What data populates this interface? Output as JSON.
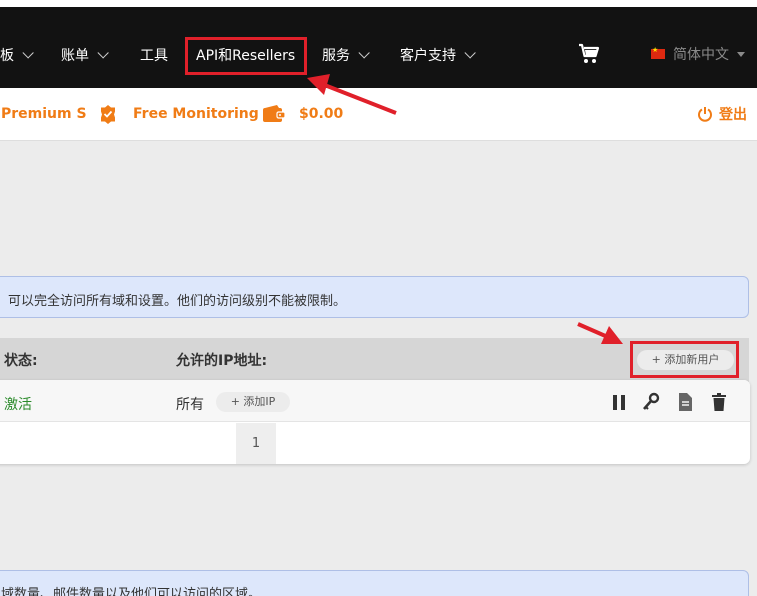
{
  "nav": {
    "items": [
      {
        "label": "板",
        "has_dropdown": true
      },
      {
        "label": "账单",
        "has_dropdown": true
      },
      {
        "label": "工具",
        "has_dropdown": false
      },
      {
        "label": "API和Resellers",
        "has_dropdown": false
      },
      {
        "label": "服务",
        "has_dropdown": true
      },
      {
        "label": "客户支持",
        "has_dropdown": true
      }
    ],
    "language": "简体中文"
  },
  "subbar": {
    "plan": "Premium S",
    "monitoring": "Free Monitoring",
    "balance": "$0.00",
    "logout": "登出"
  },
  "info_top": "可以完全访问所有域和设置。他们的访问级别不能被限制。",
  "table": {
    "col_status": "状态:",
    "col_ip": "允许的IP地址:",
    "add_user_button": "+ 添加新用户",
    "row": {
      "status": "激活",
      "ip": "所有",
      "add_ip_button": "+ 添加IP"
    },
    "page": "1"
  },
  "info_bottom": "域数量、邮件数量以及他们可以访问的区域。",
  "colors": {
    "accent": "#f07c16",
    "highlight": "#e0202a",
    "nav_bg": "#121212",
    "status_active": "#2a8a2a"
  }
}
